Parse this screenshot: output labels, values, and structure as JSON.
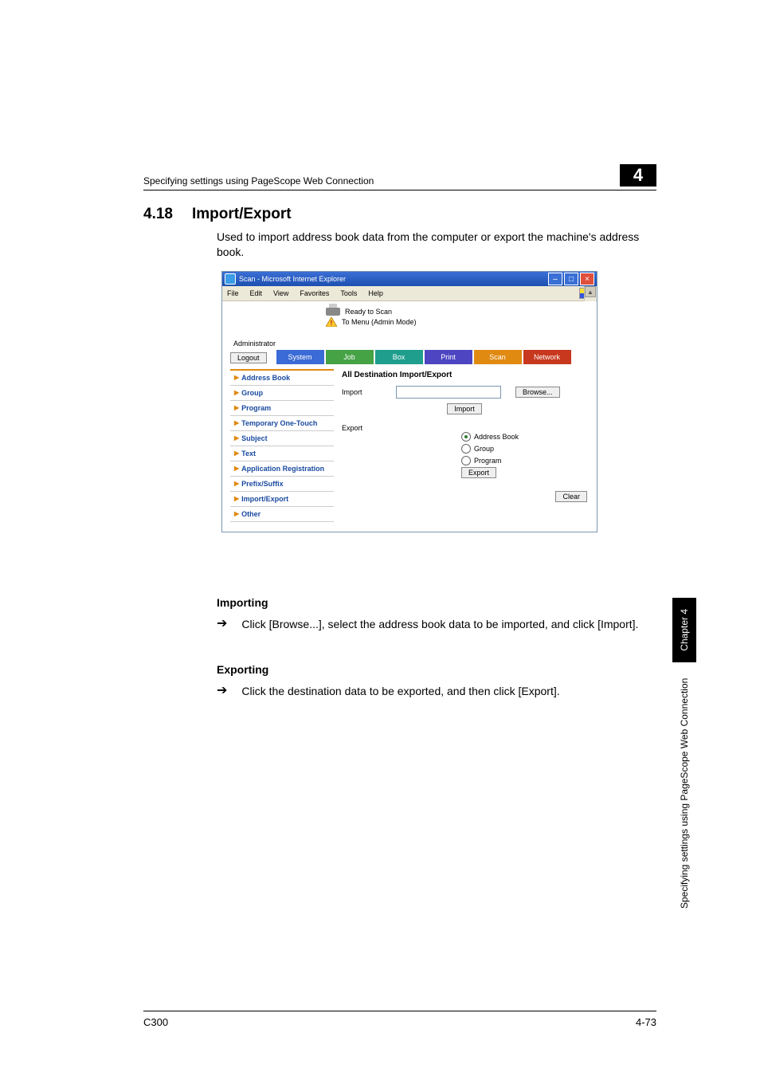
{
  "header": {
    "running_head": "Specifying settings using PageScope Web Connection",
    "chapter_number": "4"
  },
  "side": {
    "chapter_label": "Chapter 4",
    "caption": "Specifying settings using PageScope Web Connection"
  },
  "section": {
    "number": "4.18",
    "title": "Import/Export",
    "intro": "Used to import address book data from the computer or export the machine's address book."
  },
  "browser": {
    "title": "Scan - Microsoft Internet Explorer",
    "menus": [
      "File",
      "Edit",
      "View",
      "Favorites",
      "Tools",
      "Help"
    ],
    "status_ready": "Ready to Scan",
    "status_menu": "To Menu (Admin Mode)",
    "admin_label": "Administrator",
    "logout": "Logout",
    "tabs": {
      "system": "System",
      "job": "Job",
      "box": "Box",
      "print": "Print",
      "scan": "Scan",
      "network": "Network"
    },
    "sidepanel": [
      "Address Book",
      "Group",
      "Program",
      "Temporary One-Touch",
      "Subject",
      "Text",
      "Application Registration",
      "Prefix/Suffix",
      "Import/Export",
      "Other"
    ],
    "content": {
      "title": "All Destination Import/Export",
      "import_label": "Import",
      "browse_btn": "Browse...",
      "import_btn": "Import",
      "export_label": "Export",
      "radio_address": "Address Book",
      "radio_group": "Group",
      "radio_program": "Program",
      "export_btn": "Export",
      "clear_btn": "Clear"
    }
  },
  "subsections": {
    "importing_h": "Importing",
    "importing_txt": "Click [Browse...], select the address book data to be imported, and click [Import].",
    "exporting_h": "Exporting",
    "exporting_txt": "Click the destination data to be exported, and then click [Export]."
  },
  "footer": {
    "model": "C300",
    "page": "4-73"
  }
}
